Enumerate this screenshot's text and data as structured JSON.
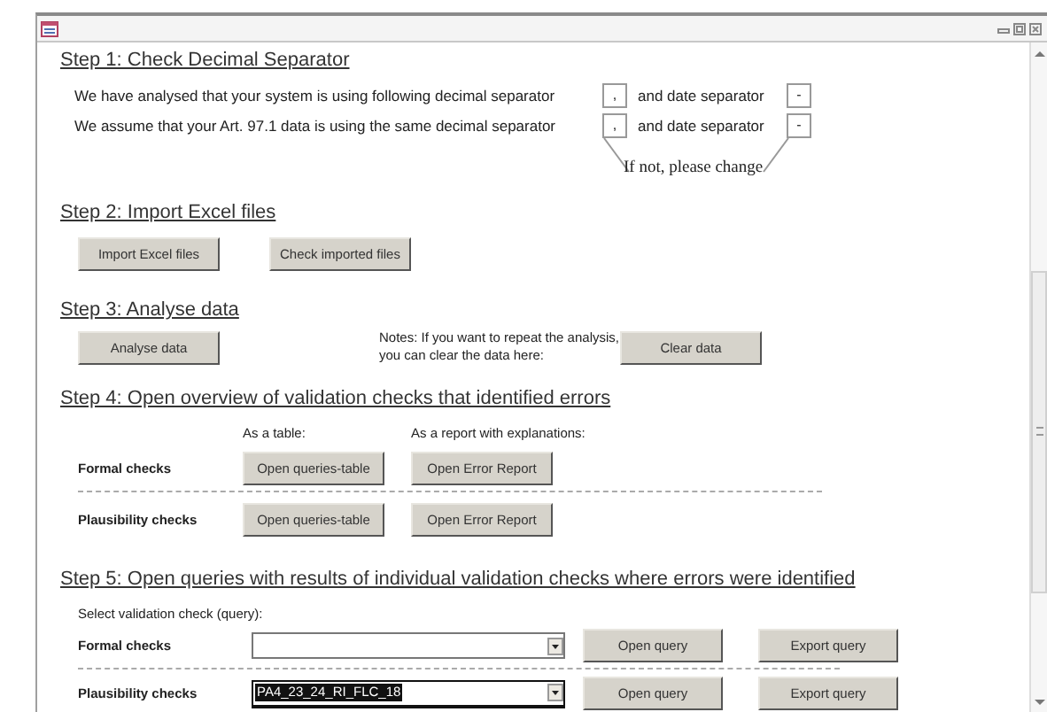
{
  "step1": {
    "heading": "Step 1: Check Decimal Separator",
    "rows": [
      {
        "text": "We have analysed that your system is using following decimal separator",
        "decimal": ",",
        "date_label": "and date separator",
        "date": "-"
      },
      {
        "text": "We assume that your Art. 97.1 data is using the same decimal separator",
        "decimal": ",",
        "date_label": "and date separator",
        "date": "-"
      }
    ],
    "note": "If not, please change"
  },
  "step2": {
    "heading": "Step 2: Import Excel files",
    "buttons": [
      "Import Excel files",
      "Check imported files"
    ]
  },
  "step3": {
    "heading": "Step 3: Analyse data",
    "button": "Analyse data",
    "note_lines": [
      "Notes: If you want to repeat the analysis,",
      "you can clear the data here:"
    ],
    "clear_button": "Clear data"
  },
  "step4": {
    "heading": "Step 4: Open overview of validation checks that identified errors",
    "columns": [
      "As a table:",
      "As a report with explanations:"
    ],
    "rows": [
      {
        "label": "Formal checks",
        "buttons": [
          "Open queries-table",
          "Open Error Report"
        ]
      },
      {
        "label": "Plausibility checks",
        "buttons": [
          "Open queries-table",
          "Open Error Report"
        ]
      }
    ]
  },
  "step5": {
    "heading": "Step 5: Open queries with results of individual validation checks where errors were identified",
    "select_label": "Select validation check (query):",
    "rows": [
      {
        "label": "Formal checks",
        "highlighted": false,
        "buttons": [
          "Open query",
          "Export query"
        ]
      },
      {
        "label": "Plausibility checks",
        "value": "PA4_23_24_RI_FLC_18",
        "highlighted": true,
        "buttons": [
          "Open query",
          "Export query"
        ]
      }
    ]
  }
}
